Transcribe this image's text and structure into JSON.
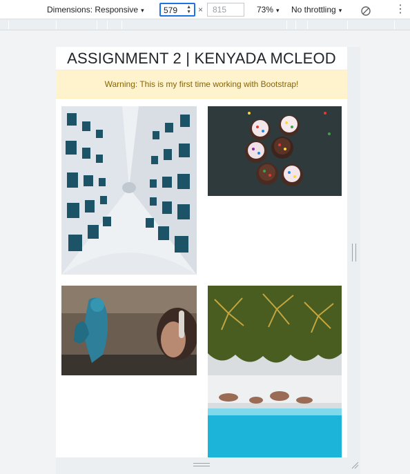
{
  "toolbar": {
    "dimensions_label": "Dimensions: Responsive",
    "width_value": "579",
    "height_placeholder": "815",
    "times": "×",
    "zoom": "73%",
    "throttling": "No throttling",
    "caret": "▾",
    "more": "⋮",
    "rotate_icon": "rotate-icon"
  },
  "page": {
    "title": "ASSIGNMENT 2 | KENYADA MCLEOD",
    "alert_text": "Warning: This is my first time working with Bootstrap!",
    "alert_color": "#fff3cd",
    "images": [
      {
        "name": "building-photo",
        "subject": "looking up between white apartment buildings"
      },
      {
        "name": "cupcakes-photo",
        "subject": "cupcakes with sprinkles on dark table"
      },
      {
        "name": "graffiti-photo",
        "subject": "graffiti wall with person wearing headphones"
      },
      {
        "name": "beach-photo",
        "subject": "aerial view of palm trees, sand and turquoise water"
      }
    ]
  }
}
